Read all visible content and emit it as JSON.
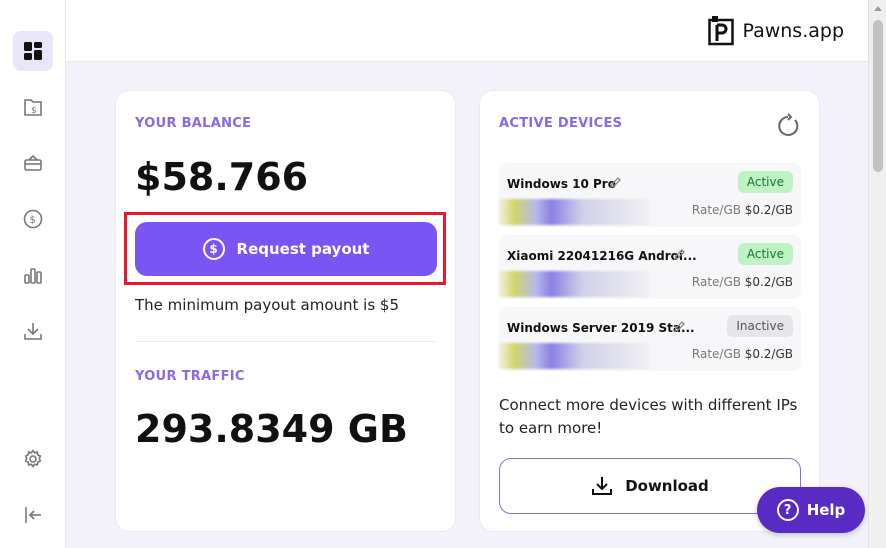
{
  "app": {
    "logo_text": "Pawns.app"
  },
  "balance": {
    "label": "YOUR BALANCE",
    "amount": "$58.766",
    "payout_button": "Request payout",
    "min_note": "The minimum payout amount is $5"
  },
  "traffic": {
    "label": "YOUR TRAFFIC",
    "amount": "293.8349 GB"
  },
  "devices": {
    "label": "ACTIVE DEVICES",
    "rate_label": "Rate/GB",
    "items": [
      {
        "name": "Windows 10 Pro",
        "status": "Active",
        "rate": "$0.2/GB"
      },
      {
        "name": "Xiaomi 22041216G Androi...",
        "status": "Active",
        "rate": "$0.2/GB"
      },
      {
        "name": "Windows Server 2019 Sta...",
        "status": "Inactive",
        "rate": "$0.2/GB"
      }
    ],
    "connect_text": "Connect more devices with different IPs to earn more!",
    "download_button": "Download"
  },
  "help": {
    "label": "Help"
  },
  "colors": {
    "accent": "#7b55f3",
    "help": "#5a2bc4",
    "highlight": "#e31b2b"
  },
  "sidebar_icons": [
    "dashboard-icon",
    "wallet-document-icon",
    "payout-card-icon",
    "dollar-circle-icon",
    "stats-bars-icon",
    "download-icon",
    "settings-icon",
    "logout-icon"
  ]
}
